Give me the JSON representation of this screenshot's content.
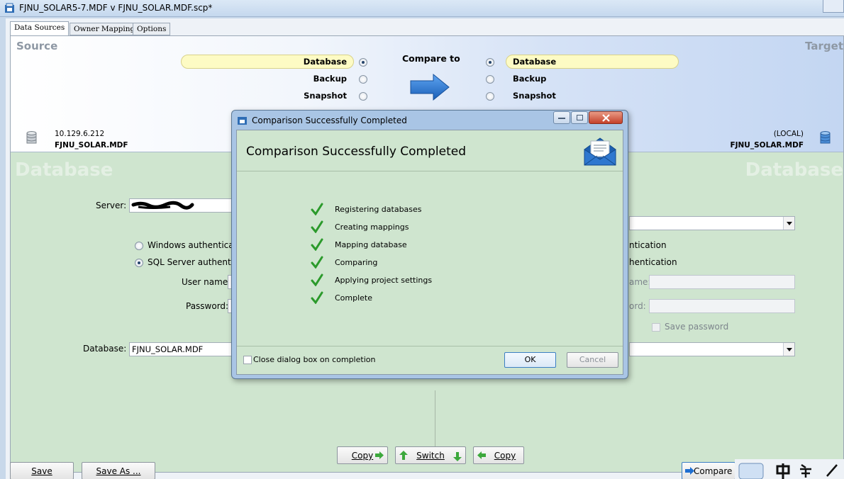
{
  "window": {
    "title": "FJNU_SOLAR5-7.MDF v FJNU_SOLAR.MDF.scp*"
  },
  "tabs": [
    {
      "label": "Data Sources",
      "active": true
    },
    {
      "label": "Owner Mapping",
      "active": false
    },
    {
      "label": "Options",
      "active": false
    }
  ],
  "header": {
    "source_title": "Source",
    "target_title": "Target",
    "compare_to": "Compare to",
    "source_options": [
      {
        "label": "Database",
        "selected": true
      },
      {
        "label": "Backup",
        "selected": false
      },
      {
        "label": "Snapshot",
        "selected": false
      }
    ],
    "target_options": [
      {
        "label": "Database",
        "selected": true
      },
      {
        "label": "Backup",
        "selected": false
      },
      {
        "label": "Snapshot",
        "selected": false
      }
    ],
    "source_server": "10.129.6.212",
    "source_db": "FJNU_SOLAR.MDF",
    "target_server": "(LOCAL)",
    "target_db": "FJNU_SOLAR.MDF"
  },
  "source": {
    "watermark": "Database",
    "server_label": "Server:",
    "windows_auth": "Windows authenticati",
    "sql_auth": "SQL Server authentic",
    "username_label": "User name:",
    "password_label": "Password:",
    "database_label": "Database:",
    "database_value": "FJNU_SOLAR.MDF"
  },
  "target": {
    "watermark": "Database",
    "windows_auth": "ntication",
    "sql_auth": "hentication",
    "username_label": "ame:",
    "password_label": "ord:",
    "save_password": "Save password"
  },
  "middle_buttons": {
    "copy_right": "Copy",
    "switch": "Switch",
    "copy_left": "Copy"
  },
  "footer": {
    "save": "Save",
    "save_as": "Save As ...",
    "compare": "Compare"
  },
  "dialog": {
    "title": "Comparison Successfully Completed",
    "heading": "Comparison Successfully Completed",
    "steps": [
      "Registering databases",
      "Creating mappings",
      "Mapping database",
      "Comparing",
      "Applying project settings",
      "Complete"
    ],
    "close_on_completion": "Close dialog box on completion",
    "ok": "OK",
    "cancel": "Cancel"
  },
  "colors": {
    "panel_green": "#cfe5cf",
    "highlight_yellow": "#fdfbc4",
    "arrow_blue": "#1f6fd1",
    "check_green": "#2b9a2b"
  }
}
